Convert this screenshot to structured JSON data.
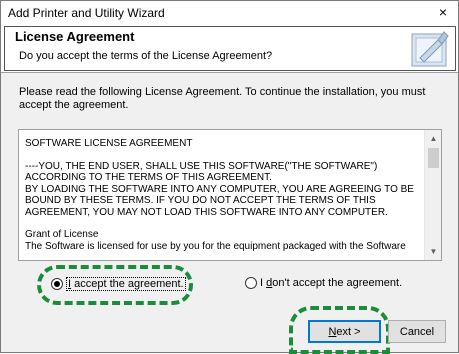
{
  "window": {
    "title": "Add Printer and Utility Wizard",
    "close_glyph": "×"
  },
  "header": {
    "title": "License Agreement",
    "subtitle": "Do you accept the terms of the License Agreement?",
    "icon": "license-document-icon"
  },
  "instructions": "Please read the following License Agreement. To continue the installation, you must accept the agreement.",
  "license": {
    "heading": "SOFTWARE LICENSE AGREEMENT",
    "para1": "----YOU, THE END USER, SHALL USE THIS SOFTWARE(\"THE SOFTWARE\") ACCORDING TO THE TERMS OF THIS AGREEMENT.",
    "para2": "BY LOADING THE SOFTWARE INTO ANY COMPUTER, YOU ARE AGREEING TO BE BOUND BY THESE TERMS. IF YOU DO NOT ACCEPT THE TERMS OF THIS AGREEMENT, YOU MAY NOT LOAD THIS SOFTWARE INTO ANY COMPUTER.",
    "grant_heading": "Grant of License",
    "grant_text": "The Software is licensed for use by you for the equipment packaged with the Software"
  },
  "options": {
    "accept": {
      "key": "I",
      "rest": " accept the agreement.",
      "selected": true
    },
    "decline": {
      "prefix": "I ",
      "key": "d",
      "rest": "on't accept the agreement.",
      "selected": false
    }
  },
  "buttons": {
    "next": {
      "key": "N",
      "rest": "ext >"
    },
    "cancel": "Cancel"
  },
  "colors": {
    "highlight": "#1b8c3a",
    "focus": "#0078d7"
  }
}
